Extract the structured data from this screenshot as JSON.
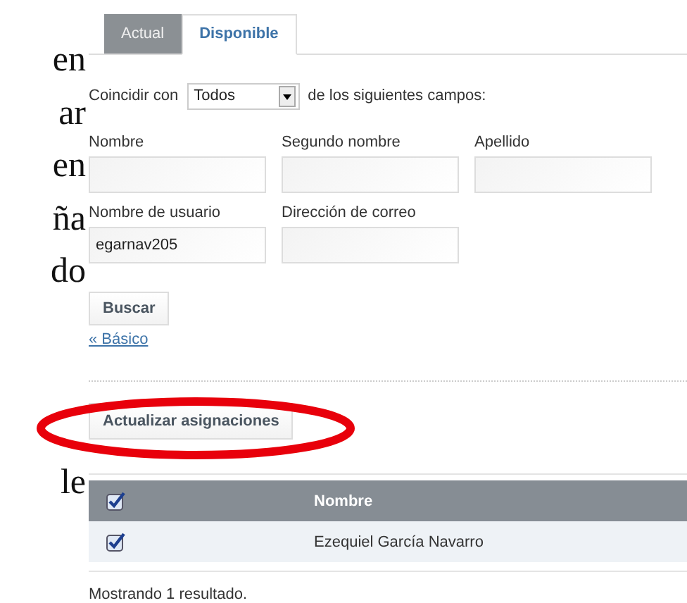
{
  "side_text": {
    "upper": [
      "en",
      "ar",
      "en",
      "ña",
      "do"
    ],
    "lower": [
      "le"
    ]
  },
  "tabs": [
    {
      "label": "Actual",
      "selected": false
    },
    {
      "label": "Disponible",
      "selected": true
    }
  ],
  "match": {
    "prefix": "Coincidir con",
    "value": "Todos",
    "suffix": "de los siguientes campos:"
  },
  "fields": [
    {
      "label": "Nombre"
    },
    {
      "label": "Segundo nombre"
    },
    {
      "label": "Apellido"
    },
    {
      "label": "Nombre de usuario",
      "value": "egarnav205"
    },
    {
      "label": "Dirección de correo"
    }
  ],
  "search_button": "Buscar",
  "basic_link": "« Básico",
  "update_button": "Actualizar asignaciones",
  "table": {
    "header_checked": true,
    "columns": [
      "Nombre"
    ],
    "rows": [
      {
        "checked": true,
        "name": "Ezequiel García Navarro"
      }
    ]
  },
  "status": "Mostrando 1 resultado."
}
